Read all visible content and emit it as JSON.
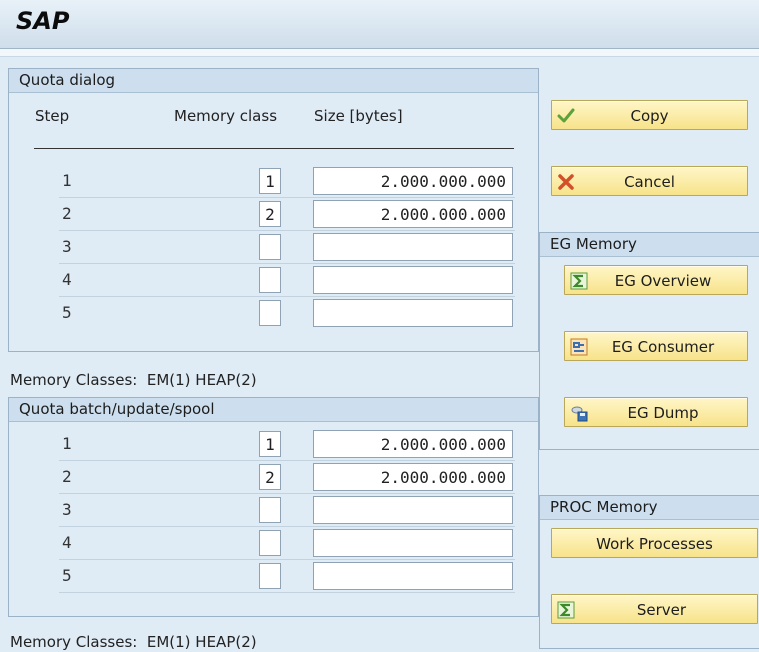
{
  "app": {
    "title": "SAP"
  },
  "quota_dialog": {
    "title": "Quota dialog",
    "headers": {
      "step": "Step",
      "memory_class": "Memory class",
      "size": "Size [bytes]"
    },
    "rows": [
      {
        "step": "1",
        "memory_class": "1",
        "size": "2.000.000.000"
      },
      {
        "step": "2",
        "memory_class": "2",
        "size": "2.000.000.000"
      },
      {
        "step": "3",
        "memory_class": "",
        "size": ""
      },
      {
        "step": "4",
        "memory_class": "",
        "size": ""
      },
      {
        "step": "5",
        "memory_class": "",
        "size": ""
      }
    ],
    "note": "Memory Classes:  EM(1) HEAP(2)"
  },
  "quota_batch": {
    "title": "Quota batch/update/spool",
    "rows": [
      {
        "step": "1",
        "memory_class": "1",
        "size": "2.000.000.000"
      },
      {
        "step": "2",
        "memory_class": "2",
        "size": "2.000.000.000"
      },
      {
        "step": "3",
        "memory_class": "",
        "size": ""
      },
      {
        "step": "4",
        "memory_class": "",
        "size": ""
      },
      {
        "step": "5",
        "memory_class": "",
        "size": ""
      }
    ],
    "note": "Memory Classes:  EM(1) HEAP(2)"
  },
  "actions": {
    "copy": "Copy",
    "cancel": "Cancel"
  },
  "eg_memory": {
    "title": "EG Memory",
    "overview": "EG Overview",
    "consumer": "EG Consumer",
    "dump": "EG Dump"
  },
  "proc_memory": {
    "title": "PROC Memory",
    "work_processes": "Work Processes",
    "server": "Server"
  },
  "icons": {
    "copy": "check-icon",
    "cancel": "x-icon",
    "overview": "sigma-icon",
    "consumer": "consumer-icon",
    "dump": "dump-icon",
    "server": "sigma-icon"
  },
  "colors": {
    "button": "#f7e38a",
    "background": "#dfebf5",
    "header": "#cddfee"
  }
}
